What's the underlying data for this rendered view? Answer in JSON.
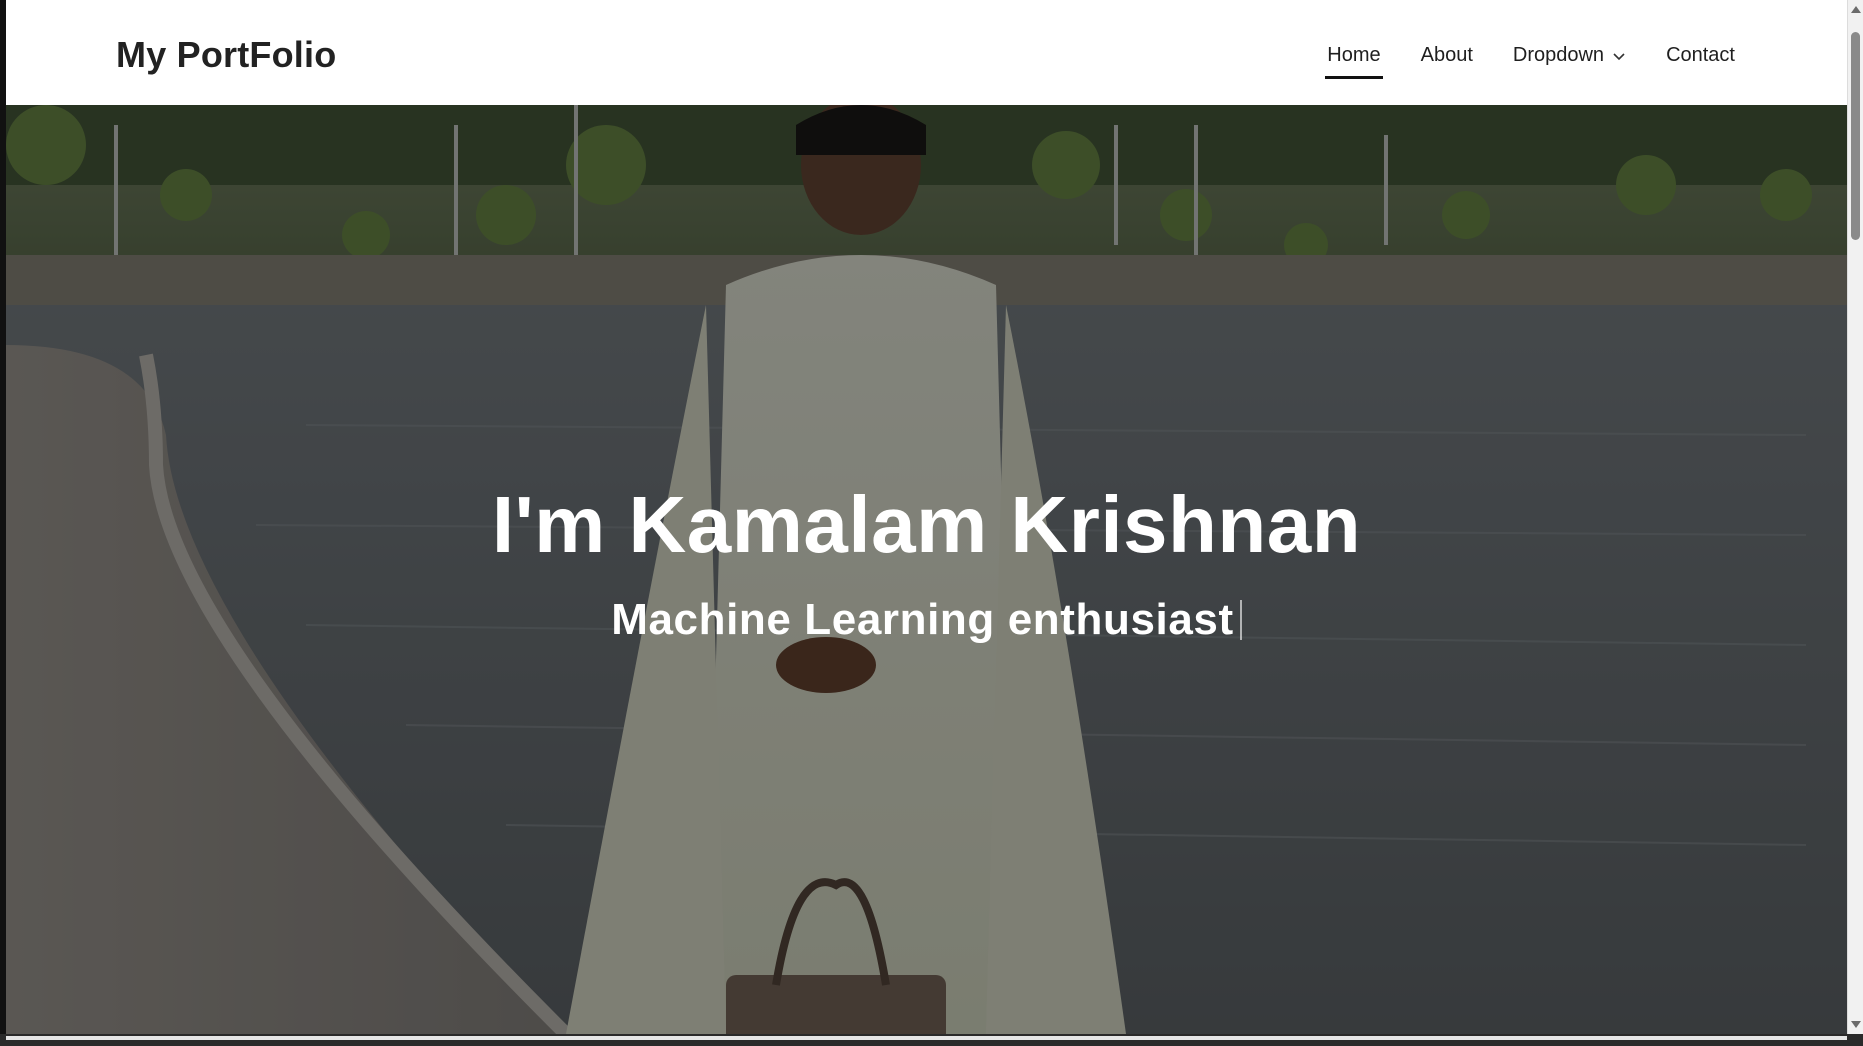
{
  "header": {
    "logo": "My PortFolio",
    "nav": [
      {
        "label": "Home",
        "active": true
      },
      {
        "label": "About",
        "active": false
      },
      {
        "label": "Dropdown",
        "active": false,
        "has_dropdown": true
      },
      {
        "label": "Contact",
        "active": false
      }
    ]
  },
  "hero": {
    "title": "I'm Kamalam Krishnan",
    "subtitle": "Machine Learning enthusiast"
  },
  "icons": {
    "dropdown": "chevron-down-icon",
    "scroll_up": "scroll-up-arrow-icon",
    "scroll_down": "scroll-down-arrow-icon"
  },
  "colors": {
    "header_bg": "#ffffff",
    "text_dark": "#222222",
    "hero_text": "#ffffff",
    "overlay": "rgba(0,0,0,0.45)"
  }
}
